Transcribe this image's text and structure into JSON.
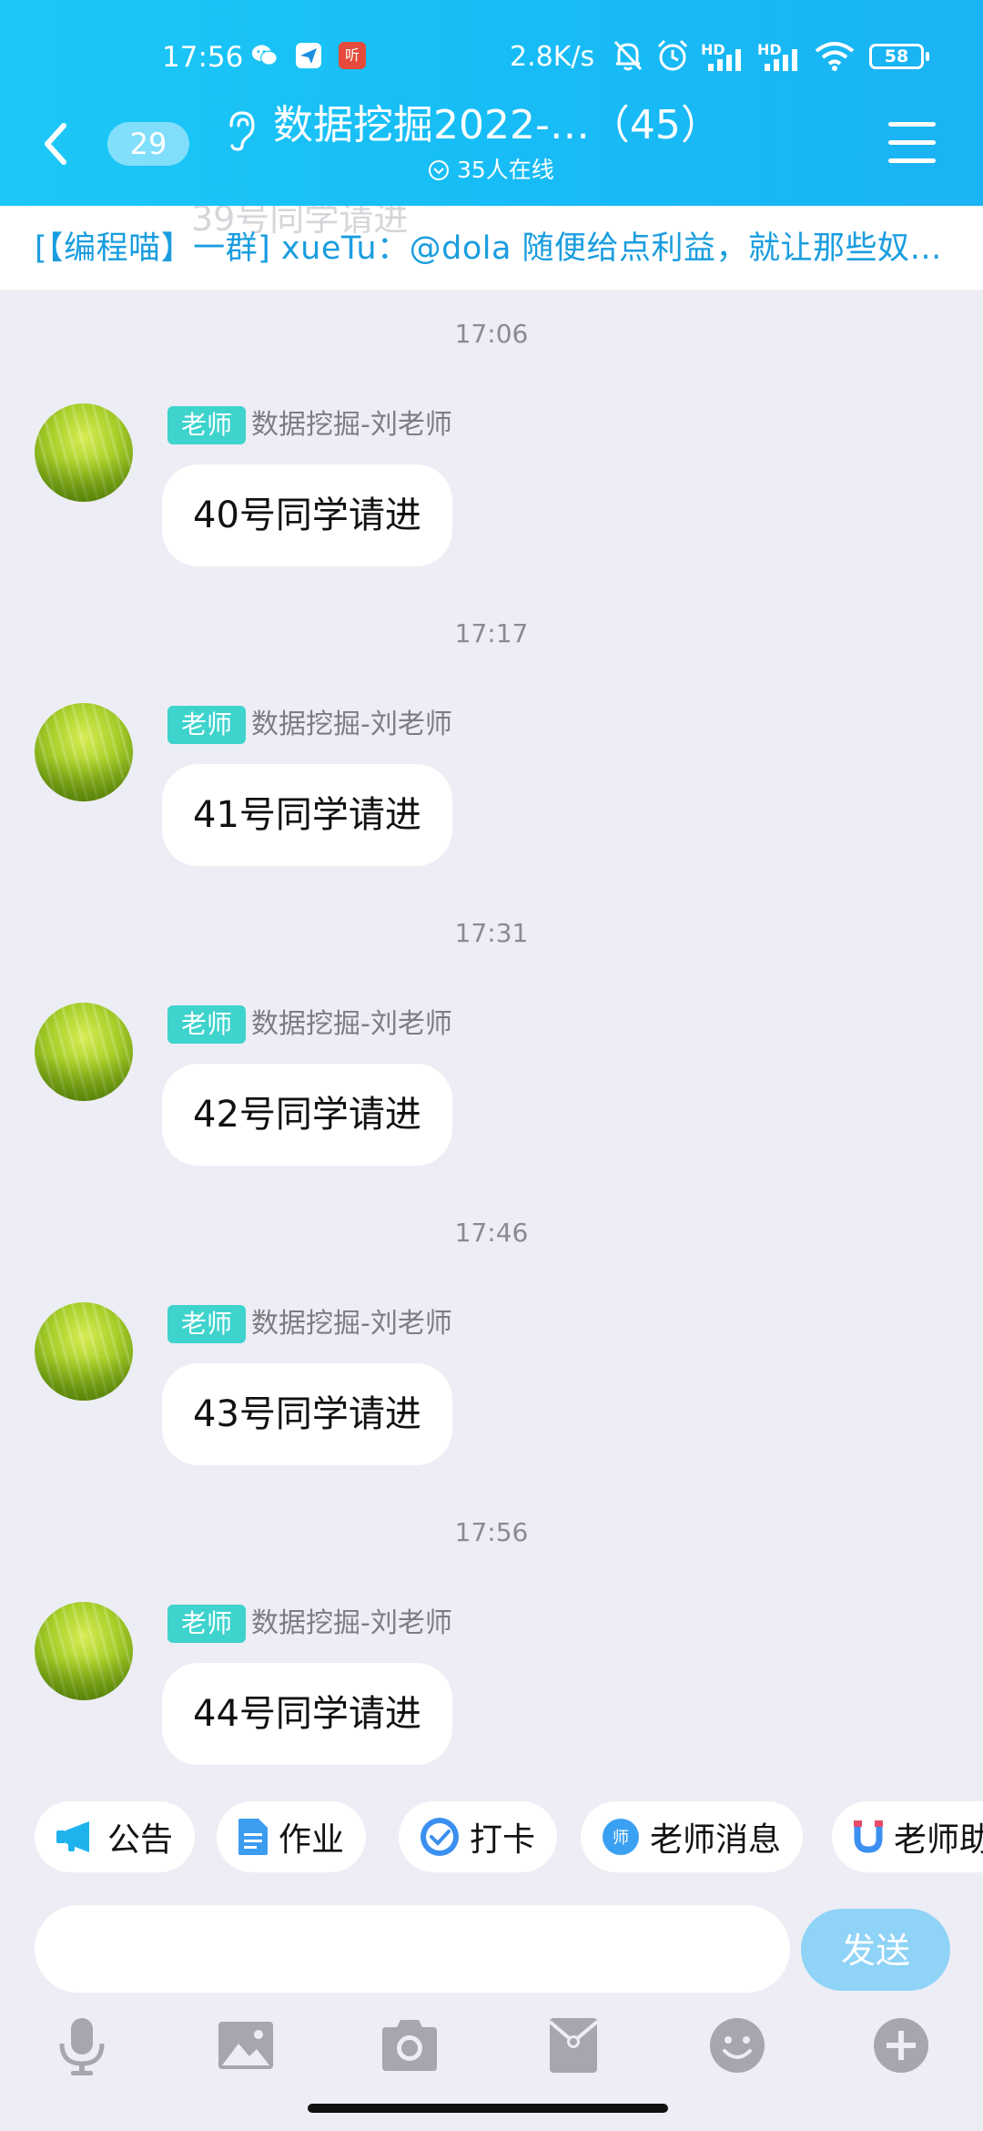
{
  "status_bar": {
    "time": "17:56",
    "net_speed": "2.8K/s",
    "hd1": "HD",
    "hd2": "HD",
    "battery": "58",
    "news_app": "听"
  },
  "header": {
    "unread_count": "29",
    "title": "数据挖掘2022-…（45）",
    "online": "35人在线"
  },
  "ticker": {
    "ghost": "39号同学请进",
    "text": "[【编程喵】一群] xueTu：@dola 随便给点利益，就让那些奴…"
  },
  "messages": [
    {
      "time": "17:06",
      "tag": "老师",
      "sender": "数据挖掘-刘老师",
      "text": "40号同学请进"
    },
    {
      "time": "17:17",
      "tag": "老师",
      "sender": "数据挖掘-刘老师",
      "text": "41号同学请进"
    },
    {
      "time": "17:31",
      "tag": "老师",
      "sender": "数据挖掘-刘老师",
      "text": "42号同学请进"
    },
    {
      "time": "17:46",
      "tag": "老师",
      "sender": "数据挖掘-刘老师",
      "text": "43号同学请进"
    },
    {
      "time": "17:56",
      "tag": "老师",
      "sender": "数据挖掘-刘老师",
      "text": "44号同学请进"
    }
  ],
  "quick_bar": [
    "公告",
    "作业",
    "打卡",
    "老师消息",
    "老师助"
  ],
  "input": {
    "value": "",
    "send_label": "发送"
  },
  "icons": {
    "wechat": "wechat-icon",
    "feishu": "send-plane-icon",
    "mute": "bell-off-icon",
    "alarm": "alarm-icon",
    "signal": "signal-icon",
    "wifi": "wifi-icon",
    "ear": "ear-icon",
    "announcement": "megaphone-icon",
    "homework": "document-icon",
    "checkin": "check-circle-icon",
    "teacher": "teacher-icon",
    "tools": [
      "mic-icon",
      "image-icon",
      "camera-icon",
      "red-packet-icon",
      "emoji-icon",
      "plus-icon"
    ]
  },
  "colors": {
    "header": "#1cc8f7",
    "ticker_text": "#1a9ddf",
    "role_tag": "#3fd3cd",
    "send_button": "#8fd3f7",
    "background": "#ededf5"
  }
}
